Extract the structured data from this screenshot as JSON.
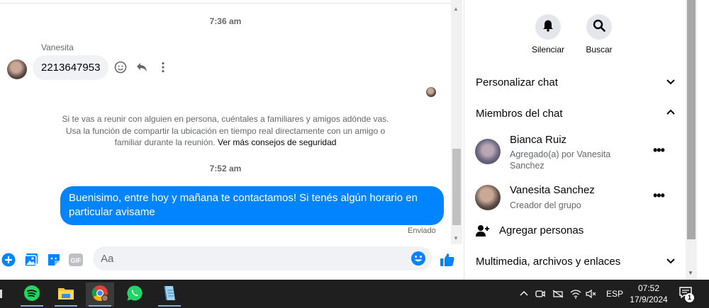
{
  "chat": {
    "time1": "7:36 am",
    "sender": "Vanesita",
    "incoming_message": "2213647953",
    "safety_text": "Si te vas a reunir con alguien en persona, cuéntales a familiares y amigos adónde vas. Usa la función de compartir la ubicación en tiempo real directamente con un amigo o familiar durante la reunión.",
    "safety_link": "Ver más consejos de seguridad",
    "time2": "7:52 am",
    "outgoing_message": "Buenisimo, entre hoy y mañana te contactamos! Si tenés algún horario en particular avisame",
    "status": "Enviado",
    "composer_placeholder": "Aa"
  },
  "side": {
    "mute_label": "Silenciar",
    "search_label": "Buscar",
    "customize_chat": "Personalizar chat",
    "chat_members": "Miembros del chat",
    "members": [
      {
        "name": "Bianca Ruiz",
        "sub": "Agregado(a) por Vanesita Sanchez"
      },
      {
        "name": "Vanesita Sanchez",
        "sub": "Creador del grupo"
      }
    ],
    "add_people": "Agregar personas",
    "media_files_links": "Multimedia, archivos y enlaces"
  },
  "taskbar": {
    "lang": "ESP",
    "time": "07:52",
    "date": "17/9/2024",
    "notifications": "1"
  },
  "colors": {
    "accent": "#0084ff",
    "bubble_in": "#f0f2f5",
    "taskbar": "#1f1f1f"
  }
}
